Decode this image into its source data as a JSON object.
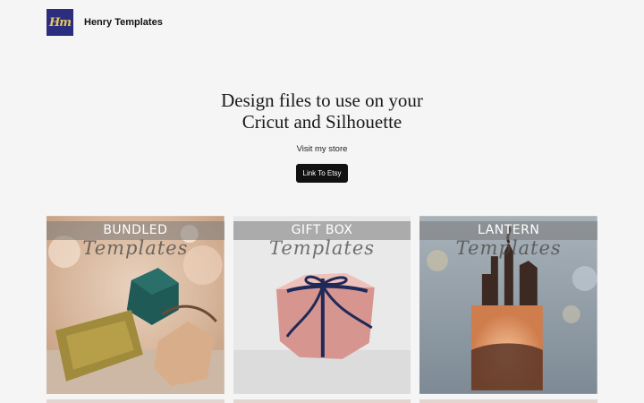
{
  "header": {
    "logo_text": "Hm",
    "brand_name": "Henry Templates"
  },
  "hero": {
    "title_line1": "Design files to use on your",
    "title_line2": "Cricut and Silhouette",
    "subtitle": "Visit my store",
    "cta_label": "Link To Etsy"
  },
  "cards": [
    {
      "title": "BUNDLED",
      "script": "Templates"
    },
    {
      "title": "GIFT BOX",
      "script": "Templates"
    },
    {
      "title": "LANTERN",
      "script": "Templates"
    }
  ],
  "colors": {
    "logo_bg": "#2b2d7f",
    "logo_text": "#e6c75a",
    "cta_bg": "#111111",
    "page_bg": "#f5f5f5"
  }
}
